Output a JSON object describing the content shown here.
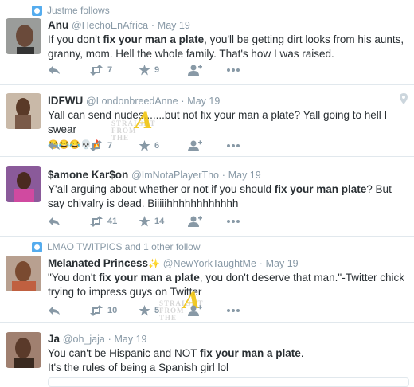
{
  "tweets": [
    {
      "context": "Justme follows",
      "name": "Anu",
      "handle": "@HechoEnAfrica",
      "time": "May 19",
      "text_parts": [
        "If you don't ",
        "fix your man a plate",
        ", you'll be getting dirt looks from his aunts, granny, mom. Hell the whole family. That's how I was raised."
      ],
      "retweets": "7",
      "likes": "9"
    },
    {
      "name": "IDFWU",
      "handle": "@LondonbreedAnne",
      "time": "May 19",
      "text_parts": [
        "Yall can send nudes.......but not fix your man a plate? Yall going to hell I swear"
      ],
      "emojis": "😂😂😂💀🔥",
      "retweets": "7",
      "likes": "6"
    },
    {
      "name": "$amone Kar$on",
      "handle": "@ImNotaPlayerTho",
      "time": "May 19",
      "text_parts": [
        "Y'all arguing about whether or not if you should ",
        "fix your man plate",
        "? But say chivalry is dead. Biiiiihhhhhhhhhhhh"
      ],
      "retweets": "41",
      "likes": "14"
    },
    {
      "context": "LMAO TWITPICS and 1 other follow",
      "name": "Melanated Princess",
      "handle": "@NewYorkTaughtMe",
      "time": "May 19",
      "text_parts": [
        "\"You don't ",
        "fix your man a plate",
        ", you don't deserve that man.\"-Twitter chick trying to impress guys on Twitter"
      ],
      "retweets": "10",
      "likes": "5"
    },
    {
      "name": "Ja",
      "handle": "@oh_jaja",
      "time": "May 19",
      "text_parts": [
        "You can't be Hispanic and NOT ",
        "fix your man a plate",
        ".",
        "It's the rules of being a Spanish girl lol"
      ]
    }
  ],
  "watermark": {
    "line1": "STRAIGHT",
    "line2": "FROM",
    "line3": "THE",
    "letter": "A"
  },
  "colors": {
    "icon": "#8899a6",
    "context_icon": "#55acee",
    "border": "#e1e8ed"
  }
}
